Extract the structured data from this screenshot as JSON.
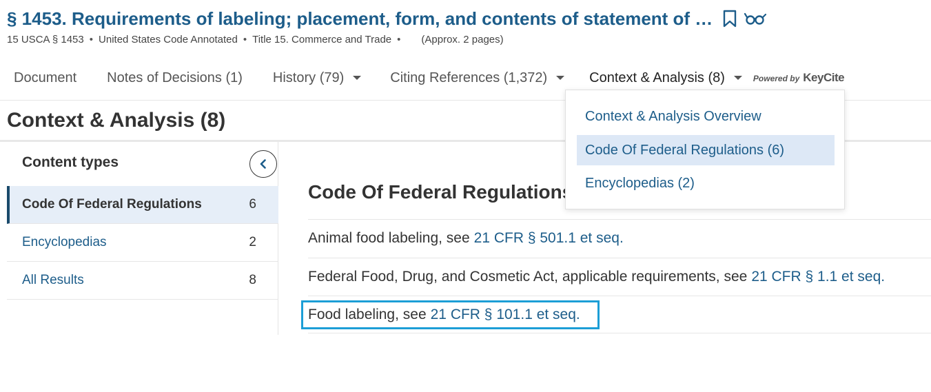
{
  "header": {
    "title": "§ 1453. Requirements of labeling; placement, form, and contents of statement of …",
    "citation": "15 USCA § 1453",
    "source": "United States Code Annotated",
    "title_path": "Title 15. Commerce and Trade",
    "pages": "(Approx. 2 pages)",
    "icons": [
      "bookmark-icon",
      "reading-glasses-icon"
    ]
  },
  "tabs": [
    {
      "label": "Document"
    },
    {
      "label": "Notes of Decisions (1)"
    },
    {
      "label": "History (79)"
    },
    {
      "label": "Citing References (1,372)"
    },
    {
      "label": "Context & Analysis (8)"
    }
  ],
  "powered_by": {
    "prefix": "Powered by",
    "brand": "KeyCite"
  },
  "dropdown": {
    "items": [
      {
        "label": "Context & Analysis Overview"
      },
      {
        "label": "Code Of Federal Regulations (6)",
        "selected": true
      },
      {
        "label": "Encyclopedias (2)"
      }
    ]
  },
  "section_title": "Context & Analysis (8)",
  "sidebar": {
    "header": "Content types",
    "items": [
      {
        "label": "Code Of Federal Regulations",
        "count": "6",
        "selected": true
      },
      {
        "label": "Encyclopedias",
        "count": "2"
      },
      {
        "label": "All Results",
        "count": "8"
      }
    ]
  },
  "main": {
    "heading": "Code Of Federal Regulations",
    "results": [
      {
        "text": "Animal food labeling, see",
        "link": "21 CFR §  501.1 et seq."
      },
      {
        "text": "Federal Food, Drug, and Cosmetic Act, applicable requirements, see",
        "link": "21 CFR §  1.1 et seq."
      },
      {
        "text": "Food labeling, see",
        "link": "21 CFR §  101.1 et seq."
      }
    ]
  },
  "colors": {
    "link": "#1d5d8a",
    "highlight": "#1c9ed6",
    "selected_bg": "#e6eef8"
  }
}
